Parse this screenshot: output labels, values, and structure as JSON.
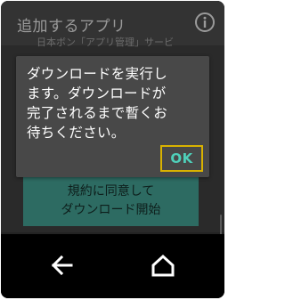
{
  "app": {
    "title": "追加するアプリ",
    "background_text": "日本ボン「アプリ管理」サービ",
    "agree_button": {
      "line1": "規約に同意して",
      "line2": "ダウンロード開始"
    }
  },
  "icons": {
    "info": "info-icon",
    "back": "back-arrow-icon",
    "home": "home-icon"
  },
  "dialog": {
    "message": "ダウンロードを実行し\nます。ダウンロードが\n完了されるまで暫くお\n待ちください。",
    "ok_label": "OK"
  },
  "colors": {
    "accent_teal": "#4fcfb9",
    "focus_outline": "#d9b200",
    "agree_button_bg": "#2d6b62"
  }
}
